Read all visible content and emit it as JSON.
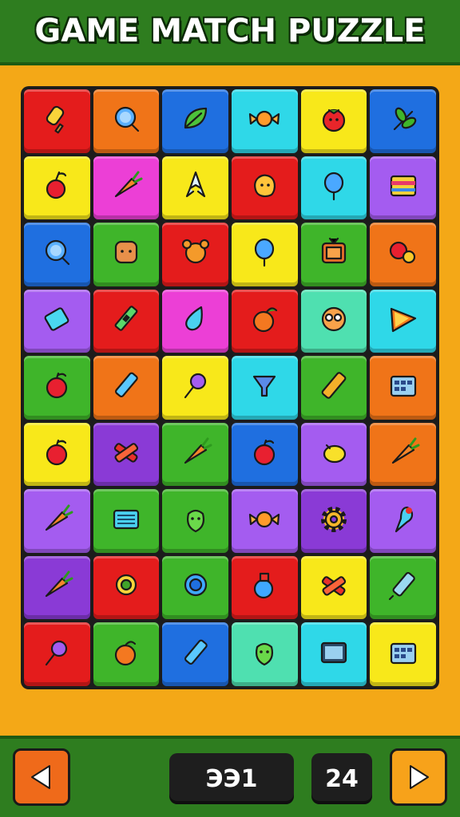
{
  "header": {
    "title": "GAME MATCH PUZZLE"
  },
  "colors": {
    "red": "#e41c1c",
    "orange": "#f07418",
    "blue": "#1f6fe0",
    "cyan": "#2fd8e8",
    "yellow": "#f8e81a",
    "pink": "#ec3fd6",
    "green": "#3fb52a",
    "purple": "#a45cf0",
    "violet": "#8a3ad6",
    "mint": "#4fe0b0"
  },
  "board": {
    "rows": [
      [
        {
          "color": "red",
          "icon": "ice-pop-icon"
        },
        {
          "color": "orange",
          "icon": "magnifier-icon"
        },
        {
          "color": "blue",
          "icon": "leaf-icon"
        },
        {
          "color": "cyan",
          "icon": "wrapped-candy-icon"
        },
        {
          "color": "yellow",
          "icon": "tomato-face-icon"
        },
        {
          "color": "blue",
          "icon": "herb-icon"
        }
      ],
      [
        {
          "color": "yellow",
          "icon": "cherry-icon"
        },
        {
          "color": "pink",
          "icon": "carrot-icon"
        },
        {
          "color": "yellow",
          "icon": "rocket-icon"
        },
        {
          "color": "red",
          "icon": "blob-icon"
        },
        {
          "color": "cyan",
          "icon": "balloon-icon"
        },
        {
          "color": "purple",
          "icon": "cake-slice-icon"
        }
      ],
      [
        {
          "color": "blue",
          "icon": "magnifier-icon"
        },
        {
          "color": "green",
          "icon": "toast-icon"
        },
        {
          "color": "red",
          "icon": "bear-icon"
        },
        {
          "color": "yellow",
          "icon": "balloon-icon"
        },
        {
          "color": "green",
          "icon": "tv-icon"
        },
        {
          "color": "orange",
          "icon": "berries-icon"
        }
      ],
      [
        {
          "color": "purple",
          "icon": "gem-icon"
        },
        {
          "color": "red",
          "icon": "pen-icon"
        },
        {
          "color": "pink",
          "icon": "drop-icon"
        },
        {
          "color": "red",
          "icon": "orange-fruit-icon"
        },
        {
          "color": "mint",
          "icon": "donut-icon"
        },
        {
          "color": "cyan",
          "icon": "pizza-icon"
        }
      ],
      [
        {
          "color": "green",
          "icon": "apple-icon"
        },
        {
          "color": "orange",
          "icon": "crayon-icon"
        },
        {
          "color": "yellow",
          "icon": "lollipop-icon"
        },
        {
          "color": "cyan",
          "icon": "funnel-icon"
        },
        {
          "color": "green",
          "icon": "bar-icon"
        },
        {
          "color": "orange",
          "icon": "calendar-icon"
        }
      ],
      [
        {
          "color": "yellow",
          "icon": "apple-icon"
        },
        {
          "color": "violet",
          "icon": "cross-icon"
        },
        {
          "color": "green",
          "icon": "carrot-icon"
        },
        {
          "color": "blue",
          "icon": "apple-icon"
        },
        {
          "color": "purple",
          "icon": "lemon-icon"
        },
        {
          "color": "orange",
          "icon": "carrot-icon"
        }
      ],
      [
        {
          "color": "purple",
          "icon": "carrot-icon"
        },
        {
          "color": "green",
          "icon": "keyboard-icon"
        },
        {
          "color": "green",
          "icon": "pepper-face-icon"
        },
        {
          "color": "purple",
          "icon": "wrapped-candy-icon"
        },
        {
          "color": "violet",
          "icon": "gear-icon"
        },
        {
          "color": "purple",
          "icon": "ice-cream-icon"
        }
      ],
      [
        {
          "color": "violet",
          "icon": "carrot-icon"
        },
        {
          "color": "red",
          "icon": "ring-icon"
        },
        {
          "color": "green",
          "icon": "target-icon"
        },
        {
          "color": "red",
          "icon": "potion-icon"
        },
        {
          "color": "yellow",
          "icon": "cross-icon"
        },
        {
          "color": "green",
          "icon": "syringe-icon"
        }
      ],
      [
        {
          "color": "red",
          "icon": "lollipop-icon"
        },
        {
          "color": "green",
          "icon": "peach-icon"
        },
        {
          "color": "blue",
          "icon": "crayon-icon"
        },
        {
          "color": "mint",
          "icon": "pepper-face-icon"
        },
        {
          "color": "cyan",
          "icon": "screen-icon"
        },
        {
          "color": "yellow",
          "icon": "calendar-icon"
        }
      ]
    ]
  },
  "footer": {
    "score": "ЭЭ1",
    "moves": "24"
  }
}
